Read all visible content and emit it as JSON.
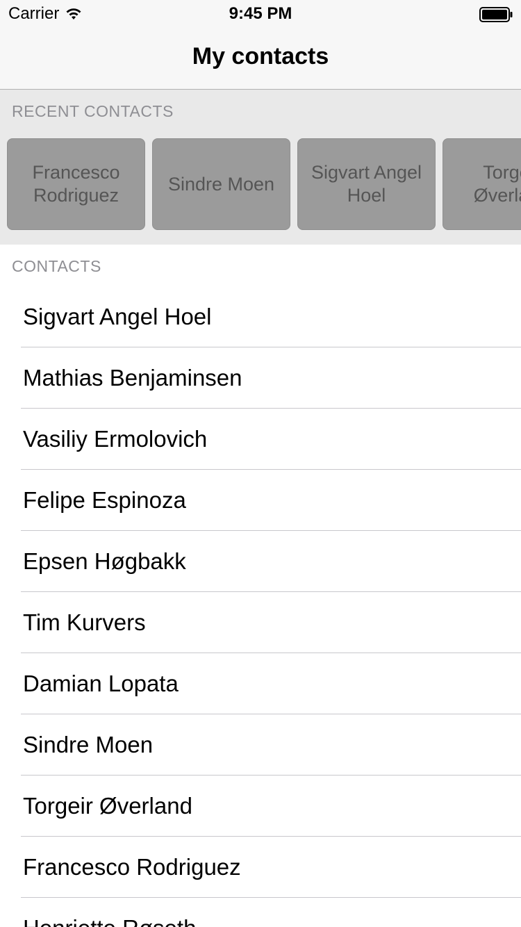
{
  "status_bar": {
    "carrier": "Carrier",
    "time": "9:45 PM"
  },
  "nav": {
    "title": "My contacts"
  },
  "recent": {
    "header": "RECENT CONTACTS",
    "items": [
      {
        "name": "Francesco Rodriguez"
      },
      {
        "name": "Sindre Moen"
      },
      {
        "name": "Sigvart Angel Hoel"
      },
      {
        "name": "Torgeir Øverland"
      }
    ]
  },
  "contacts": {
    "header": "CONTACTS",
    "items": [
      {
        "name": "Sigvart Angel Hoel"
      },
      {
        "name": "Mathias Benjaminsen"
      },
      {
        "name": "Vasiliy Ermolovich"
      },
      {
        "name": "Felipe Espinoza"
      },
      {
        "name": "Epsen Høgbakk"
      },
      {
        "name": "Tim Kurvers"
      },
      {
        "name": "Damian Lopata"
      },
      {
        "name": "Sindre Moen"
      },
      {
        "name": "Torgeir Øverland"
      },
      {
        "name": "Francesco Rodriguez"
      },
      {
        "name": "Henriette Røseth"
      }
    ]
  },
  "icons": {
    "wifi": "wifi-icon",
    "battery": "battery-icon"
  }
}
